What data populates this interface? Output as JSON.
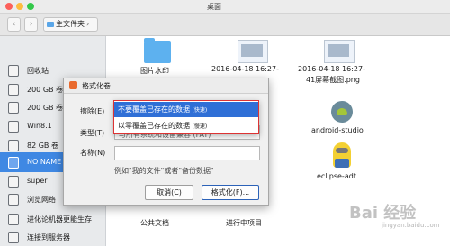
{
  "window": {
    "title": "桌面"
  },
  "toolbar": {
    "path_label": "主文件夹",
    "back": "‹",
    "forward": "›",
    "chevron": "›"
  },
  "sidebar": {
    "items": [
      {
        "label": "回收站"
      },
      {
        "label": "200 GB 卷"
      },
      {
        "label": "200 GB 卷"
      },
      {
        "label": "Win8.1"
      },
      {
        "label": "82 GB 卷"
      },
      {
        "label": "NO NAME"
      },
      {
        "label": "super"
      },
      {
        "label": "浏览网络"
      },
      {
        "label": "进化论机器更能生存"
      },
      {
        "label": "连接到服务器"
      }
    ]
  },
  "files": [
    {
      "label": "图片水印"
    },
    {
      "label_line1": "2016-04-18 16:27-",
      "label_line2": ""
    },
    {
      "label_line1": "2016-04-18 16:27-",
      "label_line2": "41屏幕截图.png"
    },
    {
      "label": "android-studio"
    },
    {
      "label": "eclipse-adt"
    },
    {
      "label": "公共文档"
    },
    {
      "label": "进行中项目"
    }
  ],
  "dialog": {
    "title": "格式化卷",
    "erase_label": "擦除(E)",
    "type_label": "类型(T)",
    "name_label": "名称(N)",
    "options": [
      {
        "text": "不要覆盖已存在的数据",
        "tag": "(快速)"
      },
      {
        "text": "以零覆盖已存在的数据",
        "tag": "(慢速)"
      }
    ],
    "type_value_partial": "与所有系统和设备兼容 (FAT)",
    "hint": "例如\"我的文件\"或者\"备份数据\"",
    "cancel": "取消(C)",
    "format": "格式化(F)..."
  },
  "watermark": {
    "main": "Bai 经验",
    "sub": "jingyan.baidu.com"
  }
}
